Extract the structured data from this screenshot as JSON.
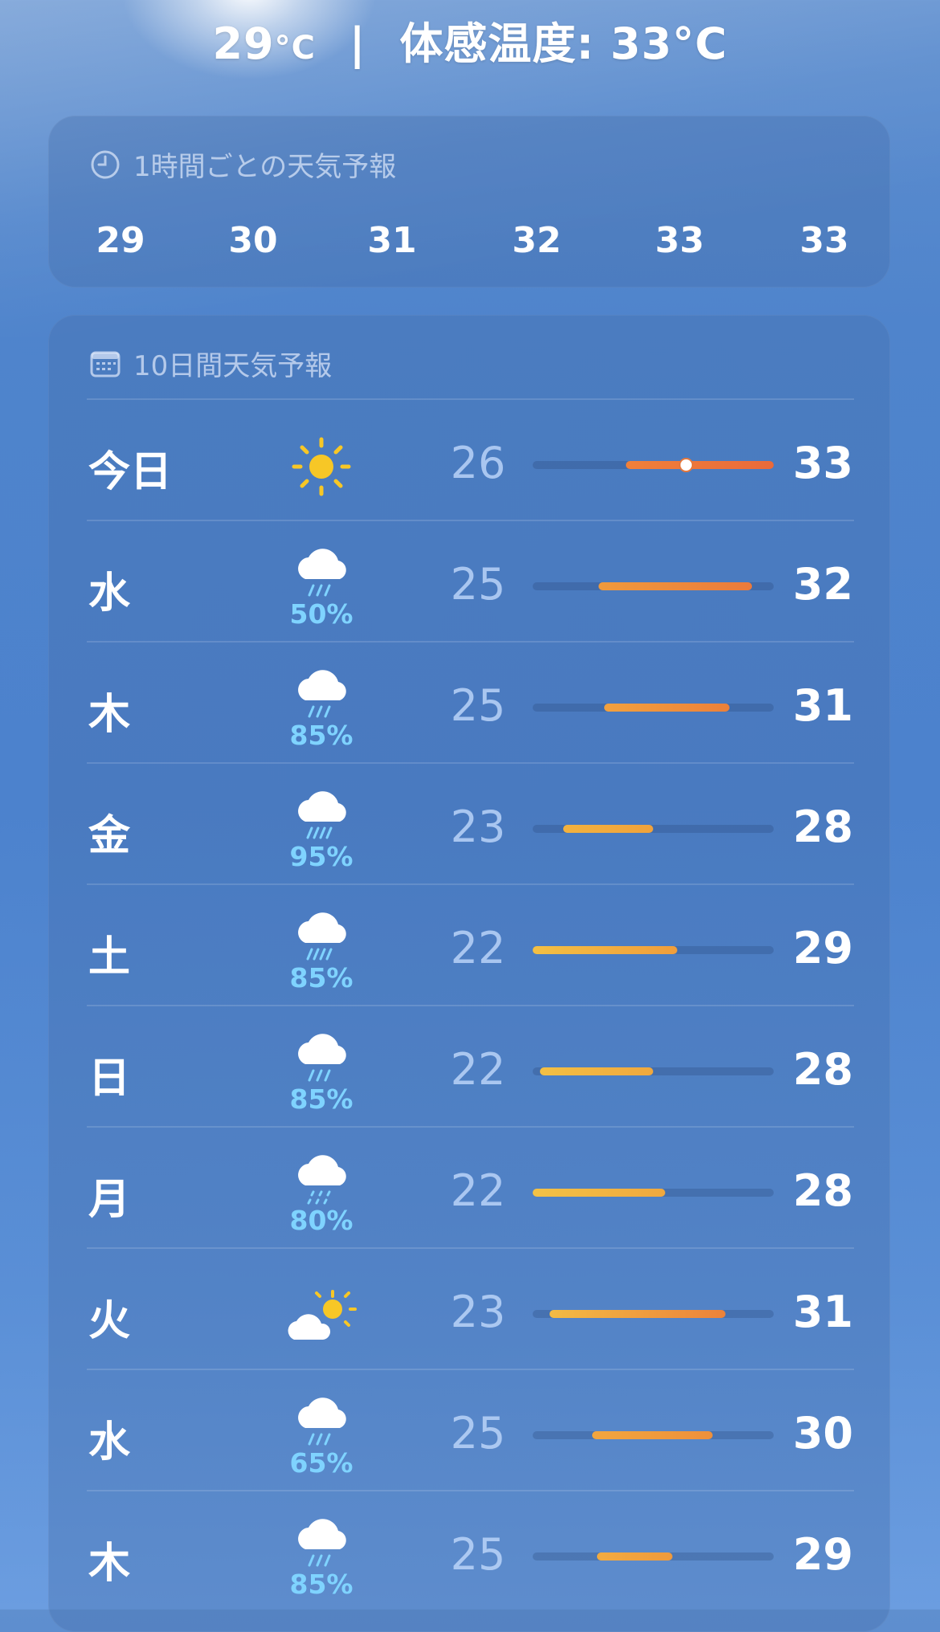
{
  "header": {
    "temp": "29",
    "temp_unit": "°C",
    "separator": "|",
    "feels_like": "体感温度: 33°C"
  },
  "hourly": {
    "title": "1時間ごとの天気予報",
    "icon": "clock-icon",
    "temps": [
      "29",
      "30",
      "31",
      "32",
      "33",
      "33"
    ]
  },
  "daily": {
    "title": "10日間天気予報",
    "icon": "calendar-icon",
    "range": [
      22,
      33
    ],
    "current_temp": 29,
    "days": [
      {
        "label": "今日",
        "icon": "sun-icon",
        "precip": "",
        "low": "26",
        "high": "33",
        "bar_from": 0.386,
        "bar_to": 1.0,
        "colors": [
          "#f0803a",
          "#ea6a3a"
        ],
        "now": true
      },
      {
        "label": "水",
        "icon": "cloud-rain-icon",
        "precip": "50%",
        "low": "25",
        "high": "32",
        "bar_from": 0.273,
        "bar_to": 0.909,
        "colors": [
          "#f09a3c",
          "#ec7a3b"
        ],
        "now": false
      },
      {
        "label": "木",
        "icon": "cloud-rain-icon",
        "precip": "85%",
        "low": "25",
        "high": "31",
        "bar_from": 0.295,
        "bar_to": 0.818,
        "colors": [
          "#f2a13e",
          "#ec803a"
        ],
        "now": false
      },
      {
        "label": "金",
        "icon": "cloud-heavy-rain-icon",
        "precip": "95%",
        "low": "23",
        "high": "28",
        "bar_from": 0.125,
        "bar_to": 0.5,
        "colors": [
          "#f3b23e",
          "#f0a23c"
        ],
        "now": false
      },
      {
        "label": "土",
        "icon": "cloud-heavy-rain-icon",
        "precip": "85%",
        "low": "22",
        "high": "29",
        "bar_from": 0.0,
        "bar_to": 0.6,
        "colors": [
          "#f3c044",
          "#f09e3c"
        ],
        "now": false
      },
      {
        "label": "日",
        "icon": "cloud-rain-icon",
        "precip": "85%",
        "low": "22",
        "high": "28",
        "bar_from": 0.03,
        "bar_to": 0.5,
        "colors": [
          "#f3c044",
          "#f0a83e"
        ],
        "now": false
      },
      {
        "label": "月",
        "icon": "cloud-drizzle-icon",
        "precip": "80%",
        "low": "22",
        "high": "28",
        "bar_from": 0.0,
        "bar_to": 0.55,
        "colors": [
          "#f3c246",
          "#f0a83e"
        ],
        "now": false
      },
      {
        "label": "火",
        "icon": "partly-cloudy-icon",
        "precip": "",
        "low": "23",
        "high": "31",
        "bar_from": 0.07,
        "bar_to": 0.8,
        "colors": [
          "#f3bb44",
          "#ec823a"
        ],
        "now": false
      },
      {
        "label": "水",
        "icon": "cloud-rain-icon",
        "precip": "65%",
        "low": "25",
        "high": "30",
        "bar_from": 0.245,
        "bar_to": 0.745,
        "colors": [
          "#f2a63e",
          "#ee903b"
        ],
        "now": false
      },
      {
        "label": "木",
        "icon": "cloud-rain-icon",
        "precip": "85%",
        "low": "25",
        "high": "29",
        "bar_from": 0.265,
        "bar_to": 0.58,
        "colors": [
          "#f2ab40",
          "#f09a3c"
        ],
        "now": false
      }
    ]
  }
}
